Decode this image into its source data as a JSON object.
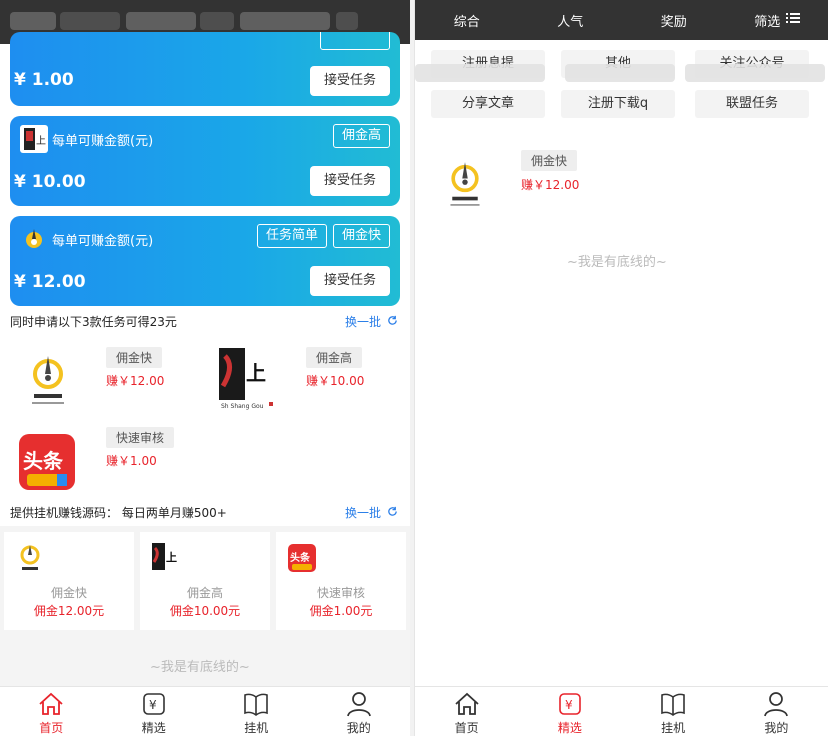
{
  "left": {
    "cards": [
      {
        "price": "¥ 1.00",
        "accept": "接受任务",
        "headtext": "",
        "tags": []
      },
      {
        "price": "¥ 10.00",
        "accept": "接受任务",
        "headtext": "每单可赚金额(元)",
        "tags": [
          "佣金高"
        ]
      },
      {
        "price": "¥ 12.00",
        "accept": "接受任务",
        "headtext": "每单可赚金额(元)",
        "tags": [
          "任务简单",
          "佣金快"
        ]
      }
    ],
    "section1": {
      "title": "同时申请以下3款任务可得23元",
      "refresh": "换一批"
    },
    "items": [
      {
        "tag": "佣金快",
        "earn": "赚￥12.00"
      },
      {
        "tag": "佣金高",
        "earn": "赚￥10.00"
      },
      {
        "tag": "快速审核",
        "earn": "赚￥1.00"
      }
    ],
    "section2": {
      "title": "提供挂机赚钱源码： 每日两单月赚500+",
      "refresh": "换一批"
    },
    "grid": [
      {
        "name": "佣金快",
        "price": "佣金12.00元"
      },
      {
        "name": "佣金高",
        "price": "佣金10.00元"
      },
      {
        "name": "快速审核",
        "price": "佣金1.00元"
      }
    ],
    "bottom": "~我是有底线的~",
    "tabs": [
      {
        "label": "首页",
        "icon": "home-icon",
        "active": true
      },
      {
        "label": "精选",
        "icon": "yen-icon",
        "active": false
      },
      {
        "label": "挂机",
        "icon": "book-icon",
        "active": false
      },
      {
        "label": "我的",
        "icon": "user-icon",
        "active": false
      }
    ]
  },
  "right": {
    "filters": [
      "综合",
      "人气",
      "奖励",
      "筛选"
    ],
    "chips": [
      "注册息提",
      "其他",
      "关注公众号",
      "分享文章",
      "注册下载q",
      "联盟任务"
    ],
    "item": {
      "tag": "佣金快",
      "earn": "赚￥12.00"
    },
    "bottom": "~我是有底线的~",
    "tabs": [
      {
        "label": "首页",
        "icon": "home-icon",
        "active": false
      },
      {
        "label": "精选",
        "icon": "yen-icon",
        "active": true
      },
      {
        "label": "挂机",
        "icon": "book-icon",
        "active": false
      },
      {
        "label": "我的",
        "icon": "user-icon",
        "active": false
      }
    ]
  },
  "colors": {
    "accent": "#e8232b",
    "link": "#2a7ee8",
    "card_start": "#1e8ef0",
    "card_end": "#21bcd4",
    "dark_bar": "#333333"
  }
}
